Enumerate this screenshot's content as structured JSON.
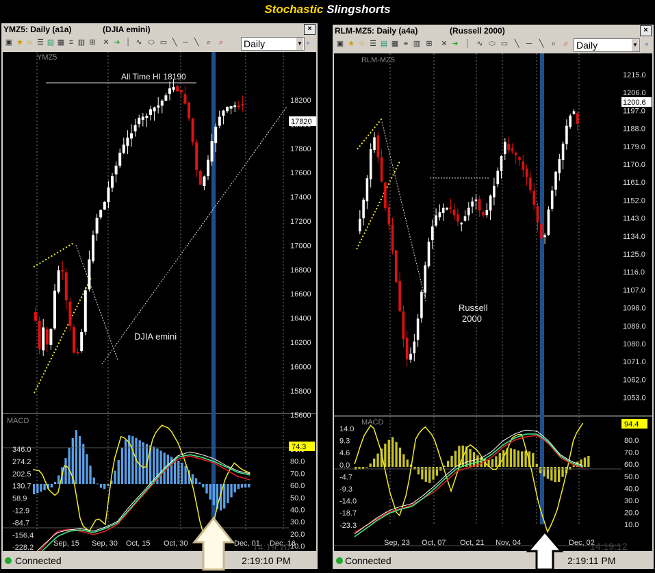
{
  "title_prefix": "Stochastic",
  "title_suffix": "Slingshorts",
  "left": {
    "symbol_label": "YMZ5: Daily (a1a)",
    "name_label": "(DJIA emini)",
    "close": "×",
    "interval": "Daily",
    "watermark": "YMZ5",
    "annotation_high": "All Time HI  18190",
    "annotation_name": "DJIA emini",
    "last_price": "17820",
    "price_ticks": [
      "18200",
      "18000",
      "17800",
      "17600",
      "17400",
      "17200",
      "17000",
      "16800",
      "16600",
      "16400",
      "16200",
      "16000",
      "15800",
      "15600"
    ],
    "macd_label": "MACD",
    "macd_ticks": [
      "346.0",
      "274.2",
      "202.5",
      "130.7",
      "58.9",
      "-12.9",
      "-84.7",
      "-156.4",
      "-228.2"
    ],
    "stoch_ticks": [
      "90.0",
      "80.0",
      "70.0",
      "60.0",
      "50.0",
      "40.0",
      "30.0",
      "20.0",
      "10.0"
    ],
    "stoch_value": "74.3",
    "date_ticks": [
      "Sep, 15",
      "Sep, 30",
      "Oct, 15",
      "Oct, 30",
      "Dec, 01",
      "Dec, 16"
    ],
    "clock_ghost": "14:19:10",
    "status_text": "Connected",
    "status_time": "2:19:10 PM"
  },
  "right": {
    "symbol_label": "RLM-MZ5: Daily (a4a)",
    "name_label": "(Russell 2000)",
    "close": "×",
    "interval": "Daily",
    "watermark": "RLM-MZ5",
    "annotation_name_1": "Russell",
    "annotation_name_2": "2000",
    "last_price": "1200.6",
    "price_ticks": [
      "1215.0",
      "1206.0",
      "1197.0",
      "1188.0",
      "1179.0",
      "1170.0",
      "1161.0",
      "1152.0",
      "1143.0",
      "1134.0",
      "1125.0",
      "1116.0",
      "1107.0",
      "1098.0",
      "1089.0",
      "1080.0",
      "1071.0",
      "1062.0",
      "1053.0"
    ],
    "macd_label": "MACD",
    "macd_ticks": [
      "14.0",
      "9.3",
      "4.6",
      "0.0",
      "-4.7",
      "-9.3",
      "-14.0",
      "-18.7",
      "-23.3"
    ],
    "stoch_ticks": [
      "80.0",
      "70.0",
      "60.0",
      "50.0",
      "40.0",
      "30.0",
      "20.0",
      "10.0"
    ],
    "stoch_value": "94.4",
    "date_ticks": [
      "Sep, 23",
      "Oct, 07",
      "Oct, 21",
      "Nov, 04",
      "8",
      "Dec, 02"
    ],
    "clock_ghost": "14:19:12",
    "status_text": "Connected",
    "status_time": "2:19:11 PM"
  },
  "colors": {
    "up": "#ffffff",
    "down": "#e01010",
    "highlight": "#1f4e8c",
    "yellow": "#f2ea2c",
    "macd_bar_left": "#5aa0e6",
    "macd_bar_right": "#c8c424",
    "signal_red": "#d22",
    "signal_green": "#3ee88a"
  }
}
